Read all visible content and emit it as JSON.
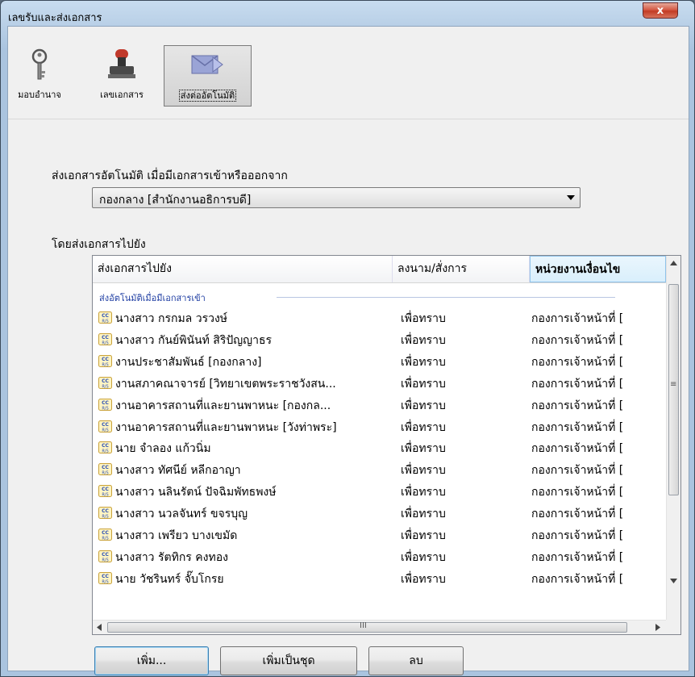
{
  "window": {
    "title": "เลขรับและส่งเอกสาร",
    "close_label": "x"
  },
  "toolbar": {
    "items": [
      {
        "label": "มอบอำนาจ",
        "icon": "key-icon"
      },
      {
        "label": "เลขเอกสาร",
        "icon": "stamp-icon"
      },
      {
        "label": "ส่งต่ออัตโนมัติ",
        "icon": "forward-mail-icon",
        "selected": true
      }
    ]
  },
  "auto_send": {
    "prompt": "ส่งเอกสารอัตโนมัติ เมื่อมีเอกสารเข้าหรือออกจาก",
    "selected_unit": "กองกลาง [สำนักงานอธิการบดี]"
  },
  "recipients": {
    "section_label": "โดยส่งเอกสารไปยัง",
    "columns": [
      "ส่งเอกสารไปยัง",
      "ลงนาม/สั่งการ",
      "หน่วยงานเงื่อนไข"
    ],
    "group_label": "ส่งอัตโนมัติเมื่อมีเอกสารเข้า",
    "rows": [
      {
        "name": "นางสาว กรกมล วรวงษ์",
        "action": "เพื่อทราบ",
        "unit": "กองการเจ้าหน้าที่ ["
      },
      {
        "name": "นางสาว กันย์พินันท์ สิริปัญญาธร",
        "action": "เพื่อทราบ",
        "unit": "กองการเจ้าหน้าที่ ["
      },
      {
        "name": "งานประชาสัมพันธ์ [กองกลาง]",
        "action": "เพื่อทราบ",
        "unit": "กองการเจ้าหน้าที่ ["
      },
      {
        "name": "งานสภาคณาจารย์ [วิทยาเขตพระราชวังสน...",
        "action": "เพื่อทราบ",
        "unit": "กองการเจ้าหน้าที่ ["
      },
      {
        "name": "งานอาคารสถานที่และยานพาหนะ [กองกล...",
        "action": "เพื่อทราบ",
        "unit": "กองการเจ้าหน้าที่ ["
      },
      {
        "name": "งานอาคารสถานที่และยานพาหนะ [วังท่าพระ]",
        "action": "เพื่อทราบ",
        "unit": "กองการเจ้าหน้าที่ ["
      },
      {
        "name": "นาย จำลอง แก้วนิ่ม",
        "action": "เพื่อทราบ",
        "unit": "กองการเจ้าหน้าที่ ["
      },
      {
        "name": "นางสาว ทัศนีย์ หลีกอาญา",
        "action": "เพื่อทราบ",
        "unit": "กองการเจ้าหน้าที่ ["
      },
      {
        "name": "นางสาว นลินรัตน์ ปัจฉิมพัทธพงษ์",
        "action": "เพื่อทราบ",
        "unit": "กองการเจ้าหน้าที่ ["
      },
      {
        "name": "นางสาว นวลจันทร์ ขจรบุญ",
        "action": "เพื่อทราบ",
        "unit": "กองการเจ้าหน้าที่ ["
      },
      {
        "name": "นางสาว เพรียว บางเขมัด",
        "action": "เพื่อทราบ",
        "unit": "กองการเจ้าหน้าที่ ["
      },
      {
        "name": "นางสาว รัตทิกร คงทอง",
        "action": "เพื่อทราบ",
        "unit": "กองการเจ้าหน้าที่ ["
      },
      {
        "name": "นาย วัชรินทร์ จั๊บโกรย",
        "action": "เพื่อทราบ",
        "unit": "กองการเจ้าหน้าที่ ["
      }
    ],
    "row_icon_text": "CC R/S"
  },
  "buttons": {
    "add": "เพิ่ม...",
    "add_set": "เพิ่มเป็นชุด",
    "delete": "ลบ"
  },
  "scrollbar": {
    "hthumb_grip": "III",
    "vthumb_grip": "≡"
  },
  "colors": {
    "title_bg": "#b9d0e7",
    "close_red": "#c23b24",
    "group_text": "#1e3da2",
    "selected_header": "#d9effc"
  }
}
